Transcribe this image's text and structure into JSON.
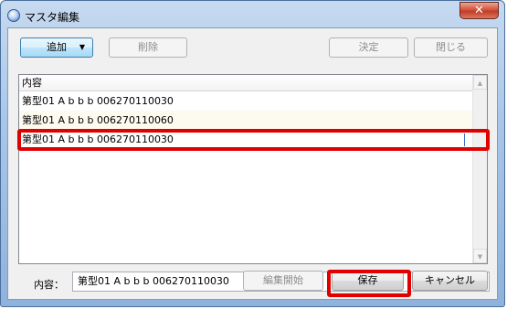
{
  "window": {
    "title": "マスタ編集",
    "close_glyph": "✕"
  },
  "toolbar": {
    "add_label": "追加",
    "add_arrow": "▼",
    "delete_label": "削除",
    "decide_label": "決定",
    "close_label": "閉じる"
  },
  "list": {
    "header": "内容",
    "rows": [
      "第型01 A b b b 006270110030",
      "第型01 A b b b 006270110060",
      "第型01 A b b b 006270110030"
    ],
    "scroll_up": "▲",
    "scroll_down": "▼"
  },
  "field": {
    "label": "内容：",
    "value": "第型01 A b b b 006270110030"
  },
  "footer": {
    "edit_start_label": "編集開始",
    "save_label": "保存",
    "cancel_label": "キャンセル"
  },
  "colors": {
    "highlight": "#e00000",
    "accent": "#3c7fb1"
  }
}
